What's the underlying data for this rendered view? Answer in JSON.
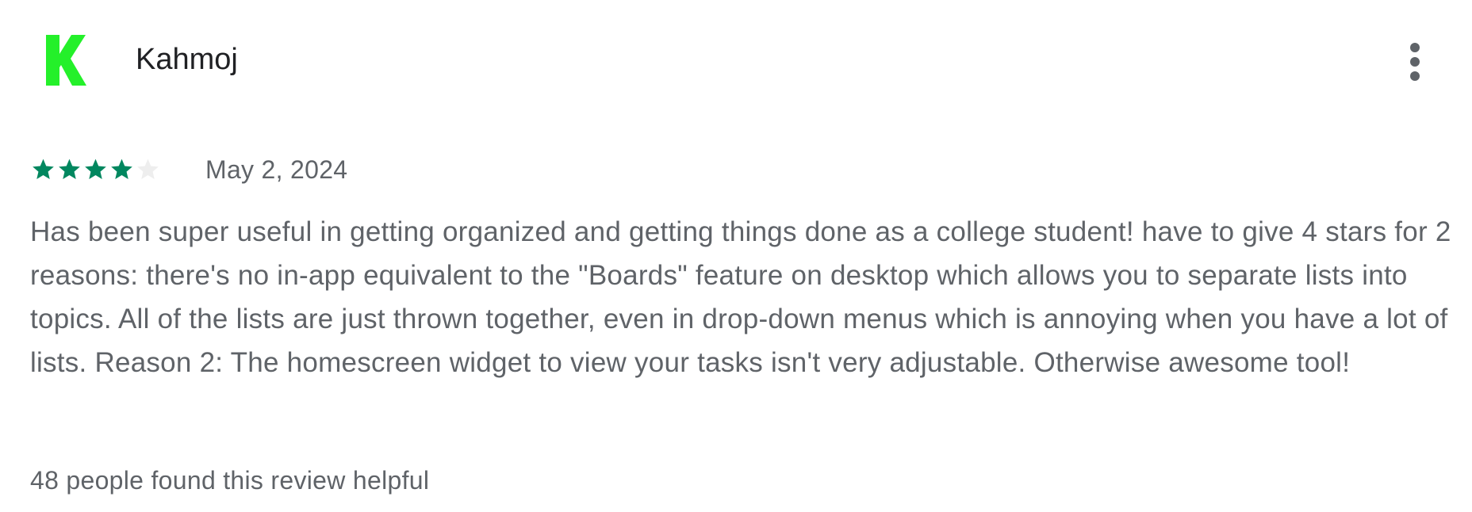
{
  "reviewer": {
    "initial": "K",
    "name": "Kahmoj",
    "avatar_color": "#24f02a"
  },
  "menu": {
    "icon": "more-vert-icon"
  },
  "rating": {
    "stars": 4,
    "max_stars": 5,
    "filled_color": "#01875f",
    "empty_color": "#eeeeee"
  },
  "review": {
    "date": "May 2, 2024",
    "text": "Has been super useful in getting organized and getting things done as a college student! have to give 4 stars for 2 reasons: there's no in-app equivalent to the \"Boards\" feature on desktop which allows you to separate lists into topics. All of the lists are just thrown together, even in drop-down menus which is annoying when you have a lot of lists. Reason 2: The homescreen widget to view your tasks isn't very adjustable. Otherwise awesome tool!",
    "helpful": "48 people found this review helpful"
  }
}
